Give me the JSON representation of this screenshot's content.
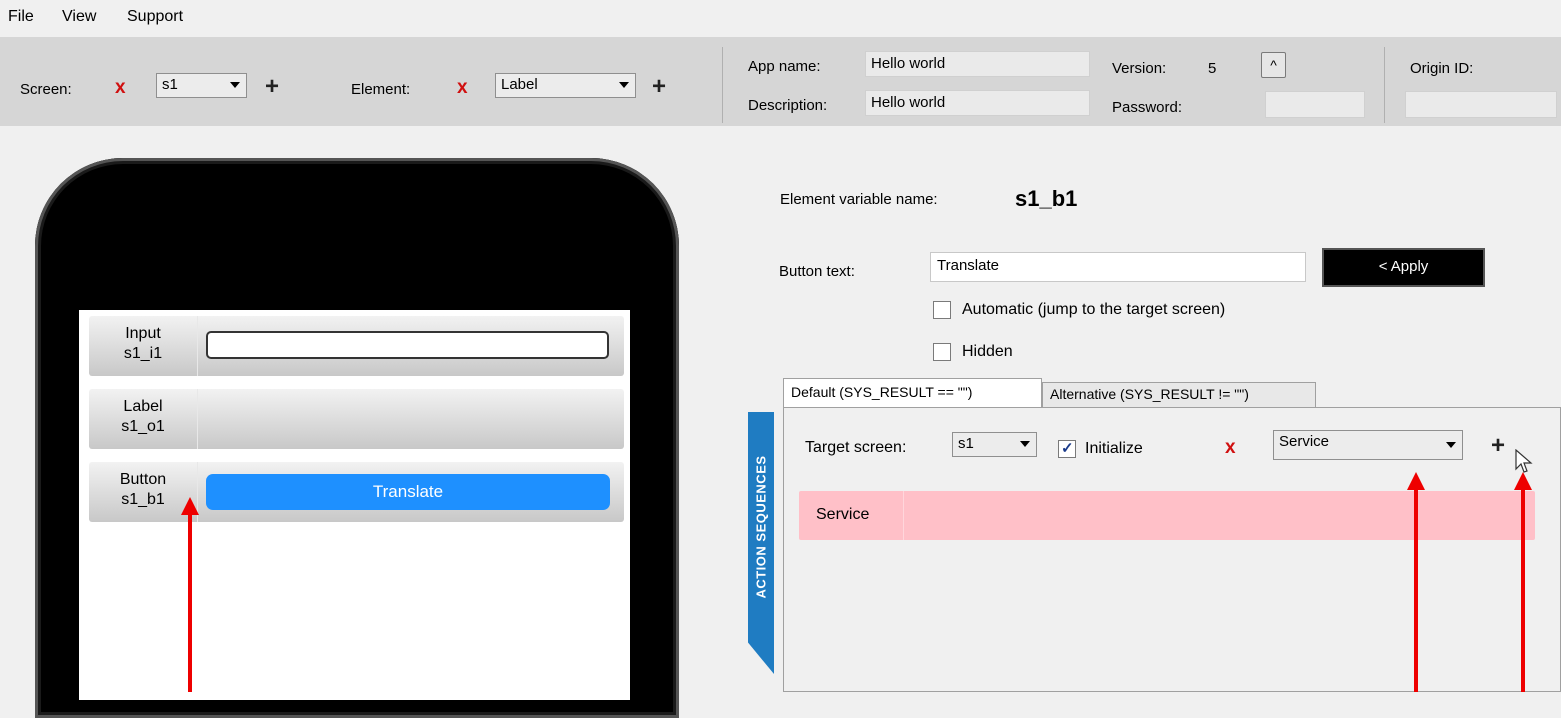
{
  "menu": {
    "file": "File",
    "view": "View",
    "support": "Support"
  },
  "toolbar": {
    "screen_label": "Screen:",
    "screen_value": "s1",
    "element_label": "Element:",
    "element_value": "Label",
    "app_name_label": "App name:",
    "app_name_value": "Hello world",
    "description_label": "Description:",
    "description_value": "Hello world",
    "version_label": "Version:",
    "version_value": "5",
    "version_button": "^",
    "password_label": "Password:",
    "password_value": "",
    "origin_label": "Origin ID:",
    "origin_value": "",
    "remove_glyph": "x",
    "add_glyph": "+"
  },
  "phone": {
    "rows": [
      {
        "type": "Input",
        "name": "s1_i1",
        "value": ""
      },
      {
        "type": "Label",
        "name": "s1_o1"
      },
      {
        "type": "Button",
        "name": "s1_b1",
        "button_text": "Translate"
      }
    ]
  },
  "props": {
    "var_label": "Element variable name:",
    "var_value": "s1_b1",
    "button_text_label": "Button text:",
    "button_text_value": "Translate",
    "apply_label": "< Apply",
    "automatic_label": "Automatic (jump to the target screen)",
    "automatic_checked": false,
    "hidden_label": "Hidden",
    "hidden_checked": false
  },
  "action": {
    "side_label": "ACTION SEQUENCES",
    "tabs": [
      "Default (SYS_RESULT == \"\")",
      "Alternative (SYS_RESULT != \"\")"
    ],
    "active_tab": 0,
    "target_label": "Target screen:",
    "target_value": "s1",
    "initialize_label": "Initialize",
    "initialize_checked": true,
    "checkmark": "✓",
    "service_value": "Service",
    "sequence_items": [
      "Service"
    ]
  },
  "colors": {
    "accent": "#1e90ff",
    "apply_bg": "#000000",
    "sequence_bg": "#ffc0c8",
    "remove": "#d01010",
    "annotation": "#ee0000"
  }
}
